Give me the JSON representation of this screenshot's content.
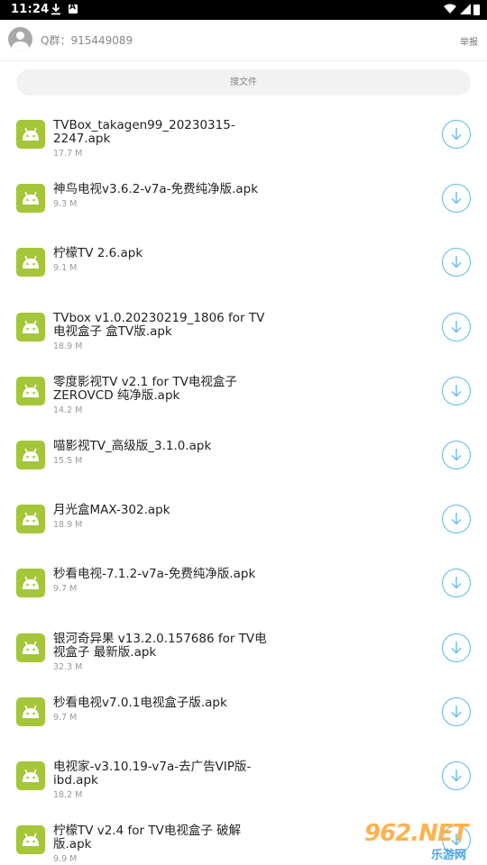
{
  "status_bar": {
    "time": "11:24",
    "icons": [
      "download-icon",
      "a-icon",
      "wifi-icon",
      "signal-icon",
      "battery-icon"
    ]
  },
  "header": {
    "qq_text": "Q群：915449089",
    "report_label": "举报"
  },
  "search": {
    "placeholder": "搜文件"
  },
  "files": [
    {
      "name": "TVBox_takagen99_20230315-2247.apk",
      "size": "17.7 M"
    },
    {
      "name": "神鸟电视v3.6.2-v7a-免费纯净版.apk",
      "size": "9.3 M"
    },
    {
      "name": "柠檬TV 2.6.apk",
      "size": "9.1 M"
    },
    {
      "name": "TVbox v1.0.20230219_1806 for TV电视盒子 盒TV版.apk",
      "size": "18.9 M"
    },
    {
      "name": "零度影视TV v2.1 for TV电视盒子ZEROVCD 纯净版.apk",
      "size": "14.2 M"
    },
    {
      "name": "喵影视TV_高级版_3.1.0.apk",
      "size": "15.5 M"
    },
    {
      "name": "月光盒MAX-302.apk",
      "size": "18.9 M"
    },
    {
      "name": "秒看电视-7.1.2-v7a-免费纯净版.apk",
      "size": "9.7 M"
    },
    {
      "name": "银河奇异果 v13.2.0.157686 for TV电视盒子 最新版.apk",
      "size": "32.3 M"
    },
    {
      "name": "秒看电视v7.0.1电视盒子版.apk",
      "size": "9.7 M"
    },
    {
      "name": "电视家-v3.10.19-v7a-去广告VIP版-ibd.apk",
      "size": "18.2 M"
    },
    {
      "name": "柠檬TV v2.4 for TV电视盒子 破解版.apk",
      "size": "9.9 M"
    }
  ],
  "watermark": {
    "top": "962.NET",
    "bottom": "乐游网"
  },
  "colors": {
    "android_green": "#a4c639",
    "download_blue": "#5bb8e6",
    "watermark_orange": "#ffb24d",
    "watermark_blue": "#4da6e6"
  }
}
